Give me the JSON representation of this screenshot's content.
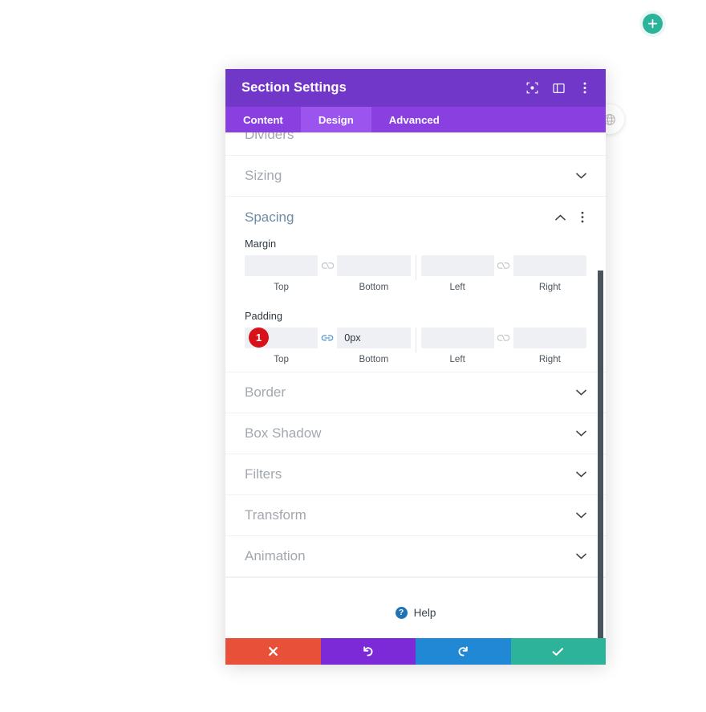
{
  "canvas": {
    "add_button_icon": "plus-icon",
    "globe_button_icon": "globe-icon"
  },
  "panel": {
    "title": "Section Settings",
    "header_icons": [
      {
        "name": "focus-target-icon",
        "label": "Preview"
      },
      {
        "name": "responsive-view-icon",
        "label": "Responsive Views"
      },
      {
        "name": "more-vertical-icon",
        "label": "More Options"
      }
    ],
    "tabs": [
      {
        "label": "Content",
        "active": false
      },
      {
        "label": "Design",
        "active": true
      },
      {
        "label": "Advanced",
        "active": false
      }
    ],
    "sections_above": [
      {
        "label": "Dividers",
        "state": "collapsed"
      }
    ],
    "sections": [
      {
        "label": "Sizing",
        "state": "collapsed",
        "icon": "chevron-down-icon"
      },
      {
        "label": "Border",
        "state": "collapsed",
        "icon": "chevron-down-icon"
      },
      {
        "label": "Box Shadow",
        "state": "collapsed",
        "icon": "chevron-down-icon"
      },
      {
        "label": "Filters",
        "state": "collapsed",
        "icon": "chevron-down-icon"
      },
      {
        "label": "Transform",
        "state": "collapsed",
        "icon": "chevron-down-icon"
      },
      {
        "label": "Animation",
        "state": "collapsed",
        "icon": "chevron-down-icon"
      }
    ],
    "spacing": {
      "label": "Spacing",
      "state": "expanded",
      "collapse_icon": "chevron-up-icon",
      "options_icon": "more-vertical-icon",
      "margin": {
        "title": "Margin",
        "top": {
          "value": "",
          "caption": "Top"
        },
        "bottom": {
          "value": "",
          "caption": "Bottom"
        },
        "left": {
          "value": "",
          "caption": "Left"
        },
        "right": {
          "value": "",
          "caption": "Right"
        },
        "link_tb": {
          "icon": "chain-broken-icon",
          "linked": false
        },
        "link_lr": {
          "icon": "chain-broken-icon",
          "linked": false
        }
      },
      "padding": {
        "title": "Padding",
        "top": {
          "value": "0px",
          "caption": "Top"
        },
        "bottom": {
          "value": "0px",
          "caption": "Bottom"
        },
        "left": {
          "value": "",
          "caption": "Left"
        },
        "right": {
          "value": "",
          "caption": "Right"
        },
        "link_tb": {
          "icon": "chain-linked-icon",
          "linked": true
        },
        "link_lr": {
          "icon": "chain-broken-icon",
          "linked": false
        }
      },
      "step_badge": "1"
    },
    "help": {
      "label": "Help",
      "icon": "question-circle-icon"
    },
    "footer_buttons": [
      {
        "name": "cancel-button",
        "icon": "close-icon",
        "color": "#e8503a"
      },
      {
        "name": "undo-button",
        "icon": "undo-icon",
        "color": "#7c2ad8"
      },
      {
        "name": "redo-button",
        "icon": "redo-icon",
        "color": "#2088d4"
      },
      {
        "name": "save-button",
        "icon": "check-icon",
        "color": "#2cb39a"
      }
    ]
  },
  "colors": {
    "header_purple": "#7137c8",
    "tabbar_purple": "#8a3fe0",
    "tab_active_purple": "#9b55ee",
    "accent_teal": "#2cb39a",
    "badge_red": "#d7121b",
    "link_blue": "#5b9bd5",
    "section_open_label": "#6e8ba5",
    "field_bg": "#eef0f3"
  }
}
